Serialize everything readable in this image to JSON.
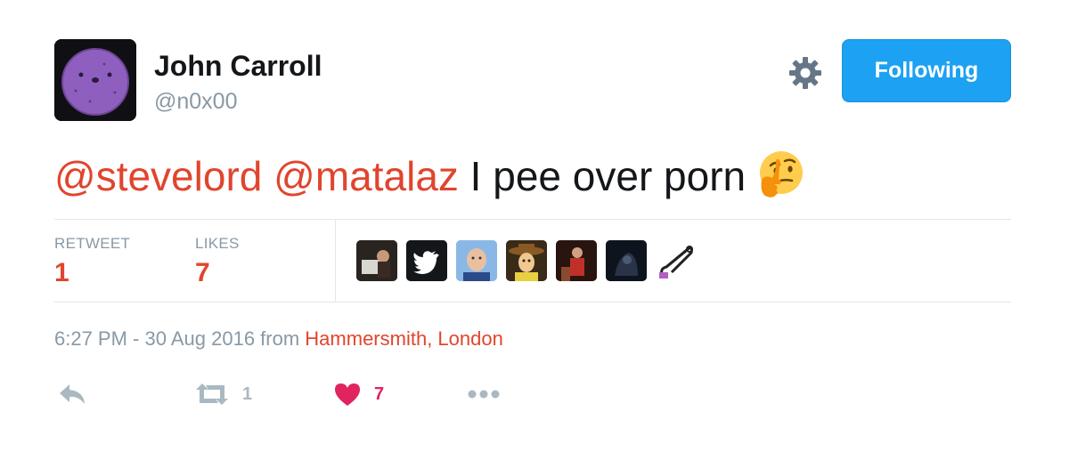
{
  "author": {
    "name": "John Carroll",
    "handle": "@n0x00"
  },
  "follow_button": {
    "label": "Following",
    "color": "#1da1f2"
  },
  "tweet": {
    "mention_1": "@stevelord",
    "mention_2": "@matalaz",
    "text": " I pee over porn",
    "emoji": "thinking-face-icon",
    "mention_color": "#e0452d"
  },
  "stats": {
    "retweets_label": "RETWEET",
    "retweets_value": "1",
    "likes_label": "LIKES",
    "likes_value": "7"
  },
  "likers": [
    {
      "name": "liker-avatar-1"
    },
    {
      "name": "twitter-bird-avatar"
    },
    {
      "name": "liker-avatar-3"
    },
    {
      "name": "woody-avatar"
    },
    {
      "name": "liker-avatar-5"
    },
    {
      "name": "liker-avatar-6"
    },
    {
      "name": "safety-pin-avatar"
    }
  ],
  "meta": {
    "timestamp": "6:27 PM - 30 Aug 2016",
    "from": " from ",
    "location": "Hammersmith, London"
  },
  "actions": {
    "reply_icon": "reply-icon",
    "retweet_icon": "retweet-icon",
    "retweet_count": "1",
    "like_icon": "heart-icon",
    "like_count": "7",
    "like_color": "#e0245e",
    "more_icon": "more-icon"
  }
}
